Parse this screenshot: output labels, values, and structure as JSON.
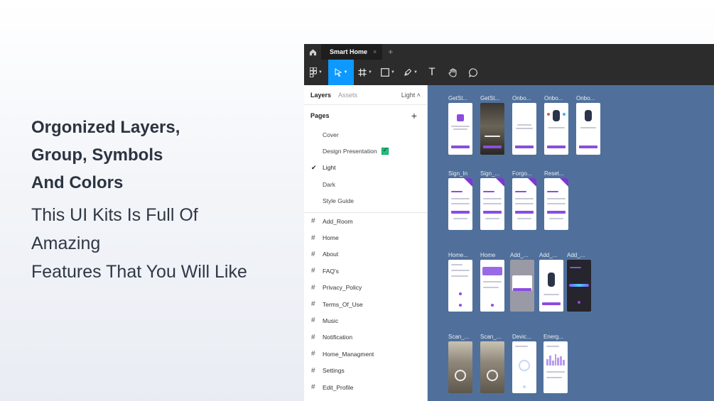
{
  "promo": {
    "heading_lines": [
      "Orgonized Layers,",
      "Group, Symbols",
      "And Colors"
    ],
    "sub_lines": [
      "This UI Kits Is Full Of",
      "Amazing",
      "Features That You Will Like"
    ]
  },
  "titlebar": {
    "home_icon": "home-icon",
    "tab_title": "Smart Home",
    "tab_close": "×",
    "new_tab": "+"
  },
  "toolbar": {
    "active_tool": "move",
    "tools": [
      "main-menu",
      "move",
      "frame",
      "shape",
      "pen",
      "text",
      "hand",
      "comment"
    ],
    "text_tool_glyph": "T"
  },
  "panel": {
    "tab_layers": "Layers",
    "tab_assets": "Assets",
    "page_selector": "Light ˄",
    "pages_title": "Pages",
    "add_page": "+",
    "pages": [
      {
        "label": "Cover"
      },
      {
        "label": "Design Presentation"
      },
      {
        "label": "Light"
      },
      {
        "label": "Dark"
      },
      {
        "label": "Style Guide"
      }
    ],
    "current_page_check": "✔",
    "frame_glyph": "#",
    "layers": [
      "Add_Room",
      "Home",
      "About",
      "FAQ's",
      "Privacy_Policy",
      "Terms_Of_Use",
      "Music",
      "Notification",
      "Home_Managment",
      "Settings",
      "Edit_Profile"
    ]
  },
  "canvas": {
    "background": "#50709b",
    "accent": "#8b4dde",
    "rows": [
      {
        "labels": [
          "GetSt...",
          "GetSt...",
          "Onbo...",
          "Onbo...",
          "Onbo..."
        ]
      },
      {
        "labels": [
          "Sign_In",
          "Sign_...",
          "Forgo...",
          "Reset..."
        ]
      },
      {
        "labels": [
          "Home...",
          "Home",
          "Add_...",
          "Add_...",
          "Add_..."
        ]
      },
      {
        "labels": [
          "Scan_...",
          "Scan_...",
          "Devic...",
          "Energ..."
        ]
      }
    ]
  },
  "colors": {
    "toolbar_bg": "#2c2c2c",
    "active_tool": "#0d99ff",
    "heading_text": "#2b3440"
  }
}
